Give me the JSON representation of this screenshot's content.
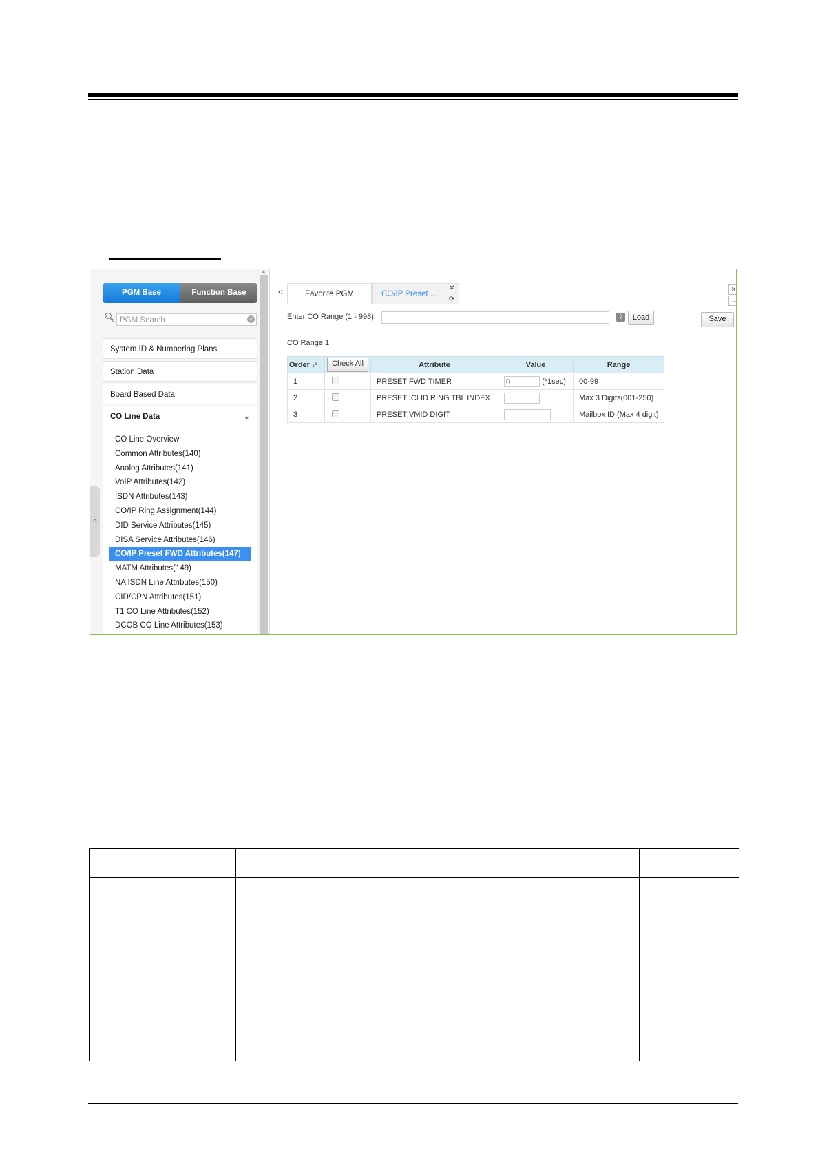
{
  "colors": {
    "frame": "#8cc152",
    "accent": "#3a8ff0",
    "header_bg": "#d9edf7"
  },
  "sidebar": {
    "toggle": {
      "pgm_base": "PGM Base",
      "function_base": "Function Base"
    },
    "search_placeholder": "PGM Search",
    "menu": [
      "System ID & Numbering Plans",
      "Station Data",
      "Board Based Data",
      "CO Line Data"
    ],
    "submenu": [
      "CO Line Overview",
      "Common Attributes(140)",
      "Analog Attributes(141)",
      "VoIP Attributes(142)",
      "ISDN Attributes(143)",
      "CO/IP Ring Assignment(144)",
      "DID Service Attributes(145)",
      "DISA Service Attributes(146)",
      "CO/IP Preset FWD Attributes(147)",
      "MATM Attributes(149)",
      "NA ISDN Line Attributes(150)",
      "CID/CPN Attributes(151)",
      "T1 CO Line Attributes(152)",
      "DCOB CO Line Attributes(153)"
    ],
    "selected": "CO/IP Preset FWD Attributes(147)"
  },
  "tabs": [
    {
      "label": "Favorite PGM"
    },
    {
      "label": "CO/IP Preset ..."
    }
  ],
  "form": {
    "range_label": "Enter CO Range (1 - 998) :",
    "range_value": "",
    "help": "?",
    "load": "Load",
    "save": "Save",
    "co_range": "CO Range 1"
  },
  "table": {
    "headers": {
      "order": "Order",
      "sort": "↓ª",
      "check_all": "Check All",
      "attribute": "Attribute",
      "value": "Value",
      "range": "Range"
    },
    "rows": [
      {
        "order": "1",
        "attribute": "PRESET FWD TIMER",
        "value": "0",
        "unit": "(*1sec)",
        "range": "00-99"
      },
      {
        "order": "2",
        "attribute": "PRESET ICLID RING TBL INDEX",
        "value": "",
        "unit": "",
        "range": "Max 3 Digits(001-250)"
      },
      {
        "order": "3",
        "attribute": "PRESET VMID DIGIT",
        "value": "",
        "unit": "",
        "range": "Mailbox ID (Max 4 digit)"
      }
    ]
  }
}
